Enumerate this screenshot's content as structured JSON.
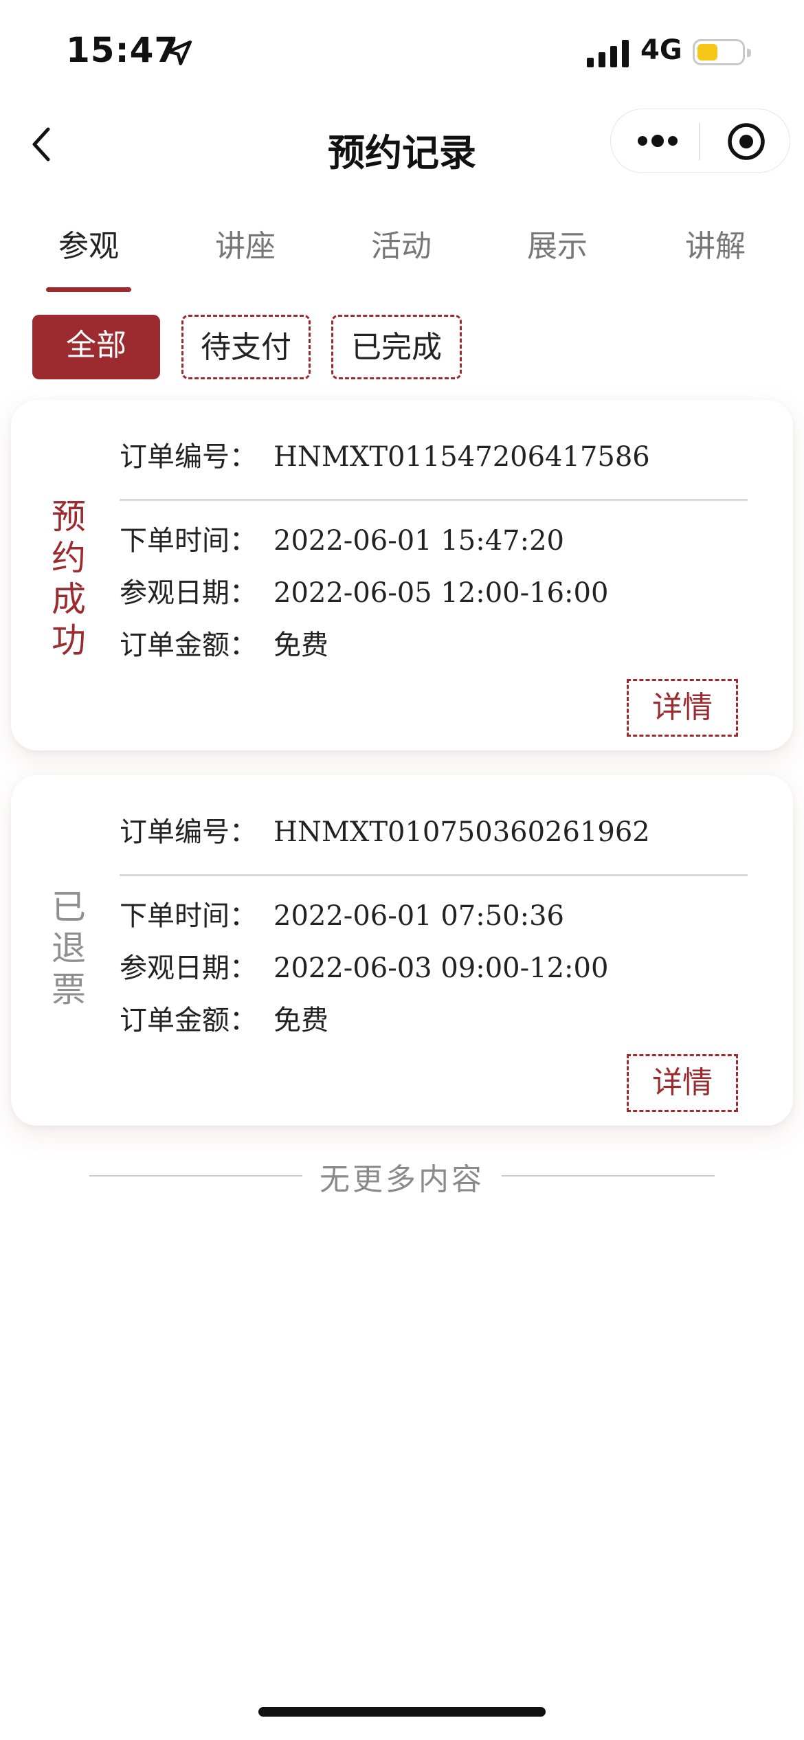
{
  "status_bar": {
    "time": "15:47",
    "network": "4G",
    "battery_level": 0.45,
    "battery_color": "#f5c518"
  },
  "nav": {
    "title": "预约记录"
  },
  "tabs": [
    {
      "label": "参观",
      "active": true
    },
    {
      "label": "讲座",
      "active": false
    },
    {
      "label": "活动",
      "active": false
    },
    {
      "label": "展示",
      "active": false
    },
    {
      "label": "讲解",
      "active": false
    }
  ],
  "filters": [
    {
      "label": "全部",
      "active": true
    },
    {
      "label": "待支付",
      "active": false
    },
    {
      "label": "已完成",
      "active": false
    }
  ],
  "labels": {
    "order_no": "订单编号：",
    "order_time": "下单时间：",
    "visit_date": "参观日期：",
    "amount": "订单金额：",
    "detail": "详情"
  },
  "orders": [
    {
      "status": "预约成功",
      "order_no": "HNMXT011547206417586",
      "order_time": "2022-06-01 15:47:20",
      "visit_date": "2022-06-05 12:00-16:00",
      "amount": "免费"
    },
    {
      "status": "已退票",
      "order_no": "HNMXT010750360261962",
      "order_time": "2022-06-01 07:50:36",
      "visit_date": "2022-06-03 09:00-12:00",
      "amount": "免费"
    }
  ],
  "footer": {
    "end_text": "无更多内容"
  },
  "colors": {
    "accent": "#9b2b2f",
    "muted": "#8f8f8f"
  }
}
